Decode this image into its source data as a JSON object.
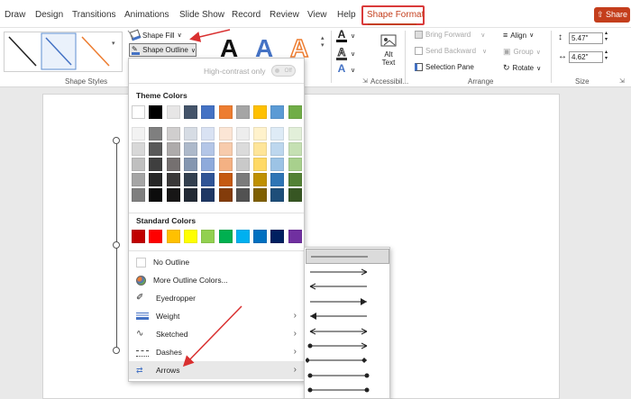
{
  "tabs": [
    "Draw",
    "Design",
    "Transitions",
    "Animations",
    "Slide Show",
    "Record",
    "Review",
    "View",
    "Help"
  ],
  "active_tab": "Shape Format",
  "share_label": "Share",
  "ribbon": {
    "shape_fill": "Shape Fill",
    "shape_outline": "Shape Outline",
    "group_shape_styles": "Shape Styles",
    "group_accessibility": "Accessibil...",
    "alt_text_line1": "Alt",
    "alt_text_line2": "Text",
    "bring_forward": "Bring Forward",
    "send_backward": "Send Backward",
    "selection_pane": "Selection Pane",
    "align": "Align",
    "group": "Group",
    "rotate": "Rotate",
    "group_arrange": "Arrange",
    "height": "5.47\"",
    "width": "4.62\"",
    "group_size": "Size",
    "wordart_letter": "A"
  },
  "menu": {
    "high_contrast": "High-contrast only",
    "toggle": "Off",
    "theme_colors_title": "Theme Colors",
    "standard_colors_title": "Standard Colors",
    "no_outline": "No Outline",
    "more_colors": "More Outline Colors...",
    "eyedropper": "Eyedropper",
    "weight": "Weight",
    "sketched": "Sketched",
    "dashes": "Dashes",
    "arrows": "Arrows"
  },
  "theme_colors": [
    "#ffffff",
    "#000000",
    "#e7e6e6",
    "#44546a",
    "#4472c4",
    "#ed7d31",
    "#a5a5a5",
    "#ffc000",
    "#5b9bd5",
    "#70ad47"
  ],
  "theme_shades": [
    [
      "#f2f2f2",
      "#7f7f7f",
      "#d0cece",
      "#d6dce4",
      "#d9e2f3",
      "#fbe5d5",
      "#ededed",
      "#fff2cc",
      "#deebf6",
      "#e2efd9"
    ],
    [
      "#d8d8d8",
      "#595959",
      "#aeabab",
      "#adb9ca",
      "#b4c6e7",
      "#f7cbac",
      "#dbdbdb",
      "#fee599",
      "#bdd7ee",
      "#c5e0b3"
    ],
    [
      "#bfbfbf",
      "#3f3f3f",
      "#757070",
      "#8496b0",
      "#8eaadb",
      "#f4b183",
      "#c9c9c9",
      "#ffd965",
      "#9cc3e5",
      "#a8d08d"
    ],
    [
      "#a5a5a5",
      "#262626",
      "#3a3838",
      "#323f4f",
      "#2f5496",
      "#c55a11",
      "#7b7b7b",
      "#bf9000",
      "#2e75b5",
      "#538135"
    ],
    [
      "#7f7f7f",
      "#0c0c0c",
      "#171616",
      "#222a35",
      "#1f3864",
      "#833c0b",
      "#525252",
      "#7f6000",
      "#1e4e79",
      "#375623"
    ]
  ],
  "standard_colors": [
    "#c00000",
    "#ff0000",
    "#ffc000",
    "#ffff00",
    "#92d050",
    "#00b050",
    "#00b0f0",
    "#0070c0",
    "#002060",
    "#7030a0"
  ]
}
